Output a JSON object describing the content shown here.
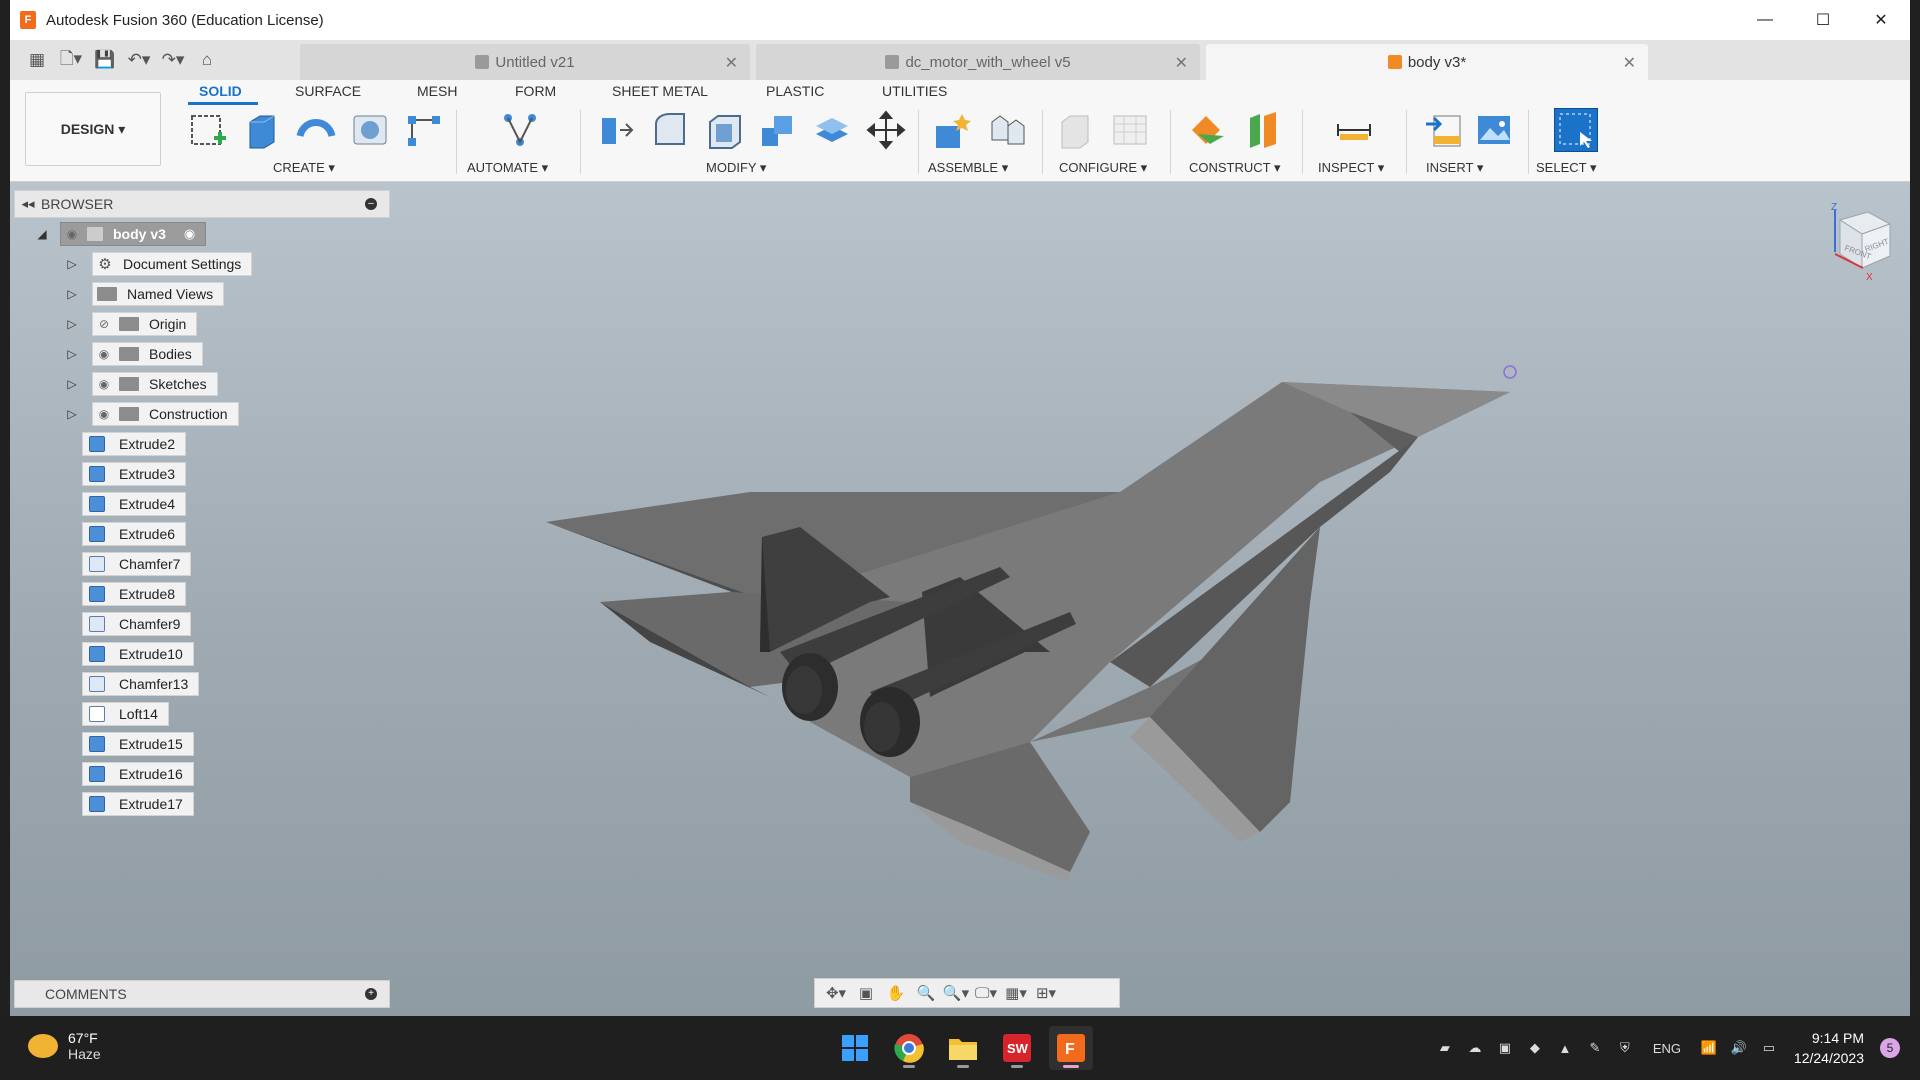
{
  "window": {
    "title": "Autodesk Fusion 360 (Education License)",
    "minimize": "—",
    "maximize": "☐",
    "close": "✕"
  },
  "document_tabs": [
    {
      "label": "Untitled v21",
      "active": false
    },
    {
      "label": "dc_motor_with_wheel v5",
      "active": false
    },
    {
      "label": "body v3*",
      "active": true
    }
  ],
  "ribbon": {
    "workspace": "DESIGN ▾",
    "tabs": [
      "SOLID",
      "SURFACE",
      "MESH",
      "FORM",
      "SHEET METAL",
      "PLASTIC",
      "UTILITIES"
    ],
    "active_tab": "SOLID",
    "groups": [
      "CREATE ▾",
      "AUTOMATE ▾",
      "MODIFY ▾",
      "ASSEMBLE ▾",
      "CONFIGURE ▾",
      "CONSTRUCT ▾",
      "INSPECT ▾",
      "INSERT ▾",
      "SELECT ▾"
    ],
    "accent": "#1a73c9"
  },
  "browser": {
    "title": "BROWSER",
    "root": "body v3",
    "folders": [
      "Document Settings",
      "Named Views",
      "Origin",
      "Bodies",
      "Sketches",
      "Construction"
    ],
    "features": [
      "Extrude2",
      "Extrude3",
      "Extrude4",
      "Extrude6",
      "Chamfer7",
      "Extrude8",
      "Chamfer9",
      "Extrude10",
      "Chamfer13",
      "Loft14",
      "Extrude15",
      "Extrude16",
      "Extrude17"
    ]
  },
  "comments": {
    "title": "COMMENTS"
  },
  "viewcube": {
    "front": "FRONT",
    "right": "RIGHT",
    "z": "Z",
    "x": "X"
  },
  "taskbar": {
    "temperature": "67°F",
    "condition": "Haze",
    "language": "ENG",
    "time": "9:14 PM",
    "date": "12/24/2023",
    "notifications": "5"
  }
}
